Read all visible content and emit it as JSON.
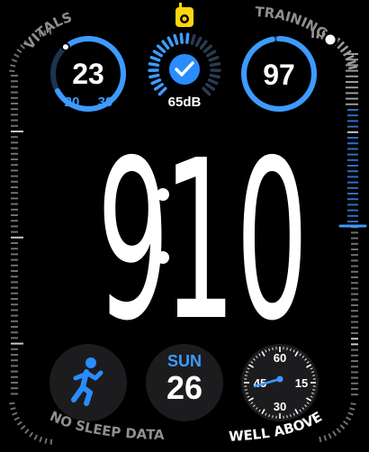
{
  "colors": {
    "accent": "#3d9bff",
    "background": "#000000",
    "warning": "#ffd60a"
  },
  "top_status_icon": "walkie-talkie-icon",
  "vitals": {
    "label": "VITALS",
    "value": "23",
    "low": "20",
    "high": "30",
    "progress": 0.78
  },
  "noise": {
    "icon": "checkmark-icon",
    "value": "65dB",
    "level": 0.55
  },
  "training": {
    "label": "TRAINING",
    "value": "97",
    "progress": 0.97
  },
  "time": {
    "hours": "9",
    "minutes": "10"
  },
  "workout": {
    "icon": "running-figure-icon"
  },
  "date": {
    "day": "SUN",
    "number": "26"
  },
  "stopwatch": {
    "marks": [
      "60",
      "15",
      "30",
      "45"
    ]
  },
  "bottom_left_label": "NO SLEEP DATA",
  "bottom_right_label": "WELL ABOVE"
}
